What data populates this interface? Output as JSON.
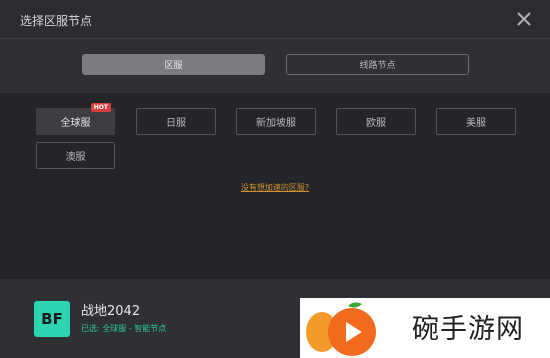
{
  "dialog": {
    "title": "选择区服节点"
  },
  "tabs": [
    {
      "label": "区服",
      "active": true
    },
    {
      "label": "线路节点",
      "active": false
    }
  ],
  "regions": [
    {
      "label": "全球服",
      "selected": true,
      "badge": "HOT"
    },
    {
      "label": "日服"
    },
    {
      "label": "新加坡服"
    },
    {
      "label": "欧服"
    },
    {
      "label": "美服"
    },
    {
      "label": "澳服"
    }
  ],
  "help_link": "没有想加速的区服?",
  "game": {
    "name": "战地2042",
    "status": "已选: 全球服 - 智能节点",
    "logo_text": "BF"
  },
  "watermark": {
    "text": "碗手游网"
  },
  "colors": {
    "accent": "#2ec59a",
    "link": "#d3932e",
    "hot_badge": "#d6413f",
    "logo_bg": "#2ed3b2"
  }
}
